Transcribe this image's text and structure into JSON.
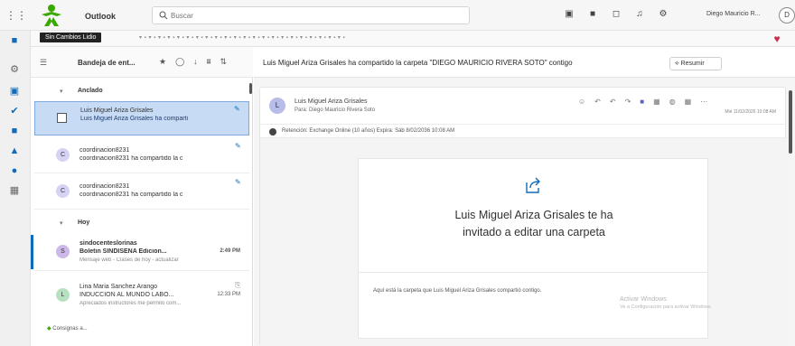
{
  "topbar": {
    "app_name": "Outlook",
    "search_placeholder": "Buscar",
    "account_name": "Diego Mauricio R..."
  },
  "ribbon": {
    "tooltip": "Sin Cambios Lidio"
  },
  "folder": {
    "title": "Bandeja de ent..."
  },
  "groups": {
    "pinned": "Anclado",
    "today": "Hoy"
  },
  "messages": [
    {
      "sender": "Luis Miguel Ariza Grisales",
      "subject": "Luis Miguel Ariza Grisales ha comparti",
      "preview": "",
      "time": "",
      "avatar": ""
    },
    {
      "sender": "coordinacion8231",
      "subject": "coordinacion8231 ha compartido la c",
      "preview": "",
      "time": "",
      "avatar": "C"
    },
    {
      "sender": "coordinacion8231",
      "subject": "coordinacion8231 ha compartido la c",
      "preview": "",
      "time": "",
      "avatar": "C"
    },
    {
      "sender": "sindocenteslorinas",
      "subject": "Boletin SINDISENA Edicion...",
      "preview": "Mensaje web - Clases de hoy - actualizar",
      "time": "2:49 PM",
      "avatar": "S"
    },
    {
      "sender": "Lina Maria Sanchez Arango",
      "subject": "INDUCCION AL MUNDO LABO...",
      "preview": "Apreciados instructores me permito com...",
      "time": "12:33 PM",
      "avatar": "L"
    }
  ],
  "tag_chip": "Consignas a...",
  "reading": {
    "subject": "Luis Miguel Ariza Grisales ha compartido la carpeta \"DIEGO MAURICIO RIVERA SOTO\" contigo",
    "summary_label": "Resumir",
    "sender_name": "Luis Miguel Ariza Grisales",
    "recipient": "Para: Diego Mauricio Rivera Soto",
    "date": "Mié 11/02/2026 10:08 AM",
    "retention": "Retención: Exchange Online (10 años) Expira: Sáb 8/02/2036 10:08 AM",
    "avatar_initial": "L",
    "invite_title_line1": "Luis Miguel Ariza Grisales te ha",
    "invite_title_line2": "invitado a editar una carpeta",
    "invite_desc": "Aquí está la carpeta que Luis Miguel Ariza Grisales compartió contigo.",
    "watermark_line1": "Activar Windows",
    "watermark_line2": "Ve a Configuración para activar Windows."
  },
  "colors": {
    "accent": "#0f6cbd",
    "selected": "#c7dcf4",
    "avatar_purple": "#b8bce8"
  }
}
